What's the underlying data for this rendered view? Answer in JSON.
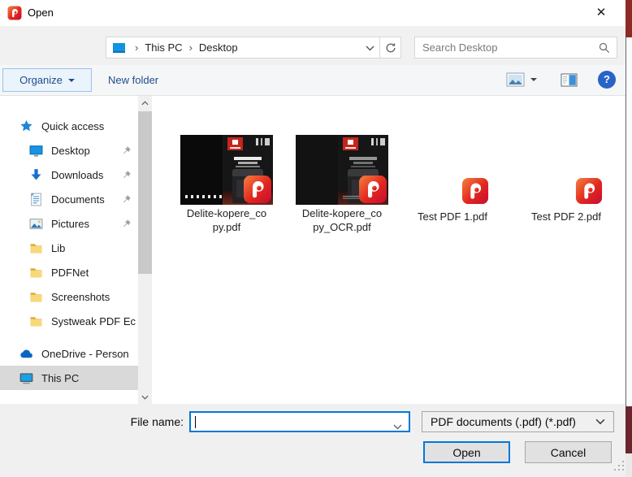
{
  "window": {
    "title": "Open",
    "close_glyph": "✕",
    "app_icon": "pdf-app-icon"
  },
  "navbar": {
    "back_icon": "arrow-left",
    "forward_icon": "arrow-right",
    "history_icon": "chevron-down",
    "up_icon": "arrow-up",
    "breadcrumb": {
      "location_icon": "desktop-location-icon",
      "separator": "›",
      "items": [
        "This PC",
        "Desktop"
      ],
      "refresh_icon": "refresh"
    },
    "search": {
      "placeholder": "Search Desktop",
      "icon": "magnifier"
    }
  },
  "toolbar": {
    "organize_label": "Organize",
    "new_folder_label": "New folder",
    "views_icon": "thumbnails-view",
    "preview_icon": "preview-pane",
    "help_glyph": "?"
  },
  "sidebar": {
    "items": [
      {
        "label": "Quick access",
        "icon": "star",
        "indent": 0,
        "pinned": false,
        "selected": false,
        "gap": 0
      },
      {
        "label": "Desktop",
        "icon": "monitor",
        "indent": 1,
        "pinned": true,
        "selected": false,
        "gap": 0
      },
      {
        "label": "Downloads",
        "icon": "download-arrow",
        "indent": 1,
        "pinned": true,
        "selected": false,
        "gap": 0
      },
      {
        "label": "Documents",
        "icon": "document",
        "indent": 1,
        "pinned": true,
        "selected": false,
        "gap": 0
      },
      {
        "label": "Pictures",
        "icon": "picture",
        "indent": 1,
        "pinned": true,
        "selected": false,
        "gap": 0
      },
      {
        "label": "Lib",
        "icon": "folder",
        "indent": 1,
        "pinned": false,
        "selected": false,
        "gap": 0
      },
      {
        "label": "PDFNet",
        "icon": "folder",
        "indent": 1,
        "pinned": false,
        "selected": false,
        "gap": 0
      },
      {
        "label": "Screenshots",
        "icon": "folder",
        "indent": 1,
        "pinned": false,
        "selected": false,
        "gap": 0
      },
      {
        "label": "Systweak PDF Ec",
        "icon": "folder",
        "indent": 1,
        "pinned": false,
        "selected": false,
        "gap": 0
      },
      {
        "label": "OneDrive - Person",
        "icon": "cloud",
        "indent": 0,
        "pinned": false,
        "selected": false,
        "gap": 10
      },
      {
        "label": "This PC",
        "icon": "computer",
        "indent": 0,
        "pinned": false,
        "selected": true,
        "gap": 0
      }
    ]
  },
  "files": {
    "items": [
      {
        "name": "Delite-kopere_copy.pdf",
        "lines": [
          "Delite-kopere_co",
          "py.pdf"
        ],
        "kind": "thumbnail"
      },
      {
        "name": "Delite-kopere_copy_OCR.pdf",
        "lines": [
          "Delite-kopere_co",
          "py_OCR.pdf"
        ],
        "kind": "thumbnail"
      },
      {
        "name": "Test PDF 1.pdf",
        "lines": [
          "Test PDF 1.pdf"
        ],
        "kind": "icon"
      },
      {
        "name": "Test PDF 2.pdf",
        "lines": [
          "Test PDF 2.pdf"
        ],
        "kind": "icon"
      }
    ]
  },
  "footer": {
    "file_name_label": "File name:",
    "file_name_value": "",
    "file_type_value": "PDF documents (.pdf) (*.pdf)",
    "open_label": "Open",
    "cancel_label": "Cancel"
  },
  "colors": {
    "accent": "#0078d7",
    "command_text": "#1d4e89",
    "app_red": "#e2261f",
    "selected_row": "#d9d9d9"
  }
}
